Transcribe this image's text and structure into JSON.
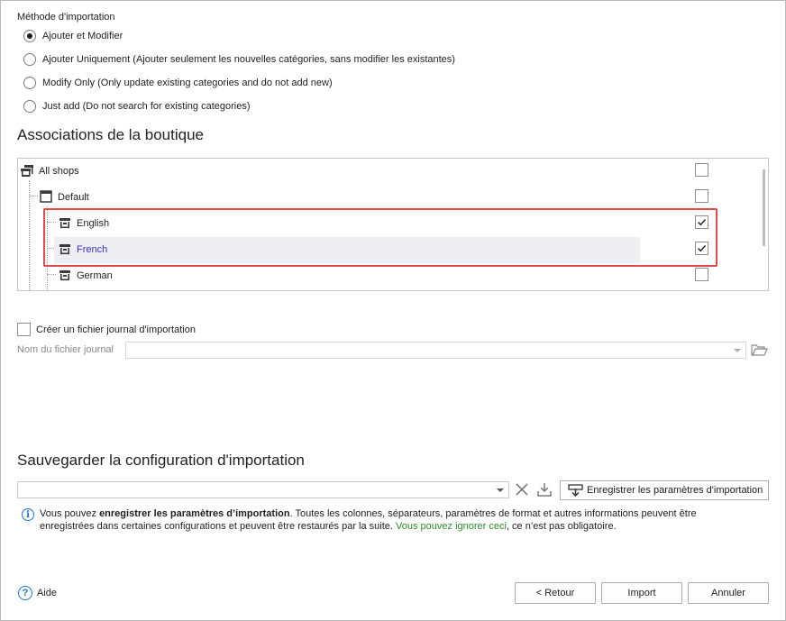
{
  "import_method": {
    "label": "Méthode d'importation",
    "options": [
      {
        "label": "Ajouter et Modifier",
        "selected": true
      },
      {
        "label": "Ajouter Uniquement (Ajouter seulement les nouvelles catégories, sans modifier les existantes)",
        "selected": false
      },
      {
        "label": "Modify Only (Only update existing categories and do not add new)",
        "selected": false
      },
      {
        "label": "Just add (Do not search for existing categories)",
        "selected": false
      }
    ]
  },
  "shop_associations": {
    "title": "Associations de la boutique",
    "tree": [
      {
        "label": "All shops",
        "checked": false,
        "icon": "shop-group-icon"
      },
      {
        "label": "Default",
        "checked": false,
        "icon": "window-icon"
      },
      {
        "label": "English",
        "checked": true,
        "icon": "store-icon"
      },
      {
        "label": "French",
        "checked": true,
        "icon": "store-icon",
        "selected": true
      },
      {
        "label": "German",
        "checked": false,
        "icon": "store-icon"
      }
    ]
  },
  "log": {
    "create_label": "Créer un fichier journal d'importation",
    "create_checked": false,
    "file_label": "Nom du fichier journal",
    "file_value": ""
  },
  "save_config": {
    "title": "Sauvegarder la configuration d'importation",
    "select_value": "",
    "save_button": "Enregistrer les paramètres d'importation",
    "info_prefix": "Vous pouvez ",
    "info_bold": "enregistrer les paramètres d’importation",
    "info_middle": ". Toutes les colonnes, séparateurs, paramètres de format et autres informations peuvent être enregistrées dans certaines configurations et peuvent être restaurés par la suite. ",
    "info_green": "Vous pouvez ignorer ceci",
    "info_suffix": ", ce n’est pas obligatoire."
  },
  "footer": {
    "help": "Aide",
    "back": "< Retour",
    "import": "Import",
    "cancel": "Annuler"
  },
  "colors": {
    "highlight_border": "#e04c4c",
    "selected_row": "#eeeef5",
    "selected_text": "#3a2fb0",
    "info_icon": "#1a73c7",
    "green_text": "#2c8a2c"
  }
}
